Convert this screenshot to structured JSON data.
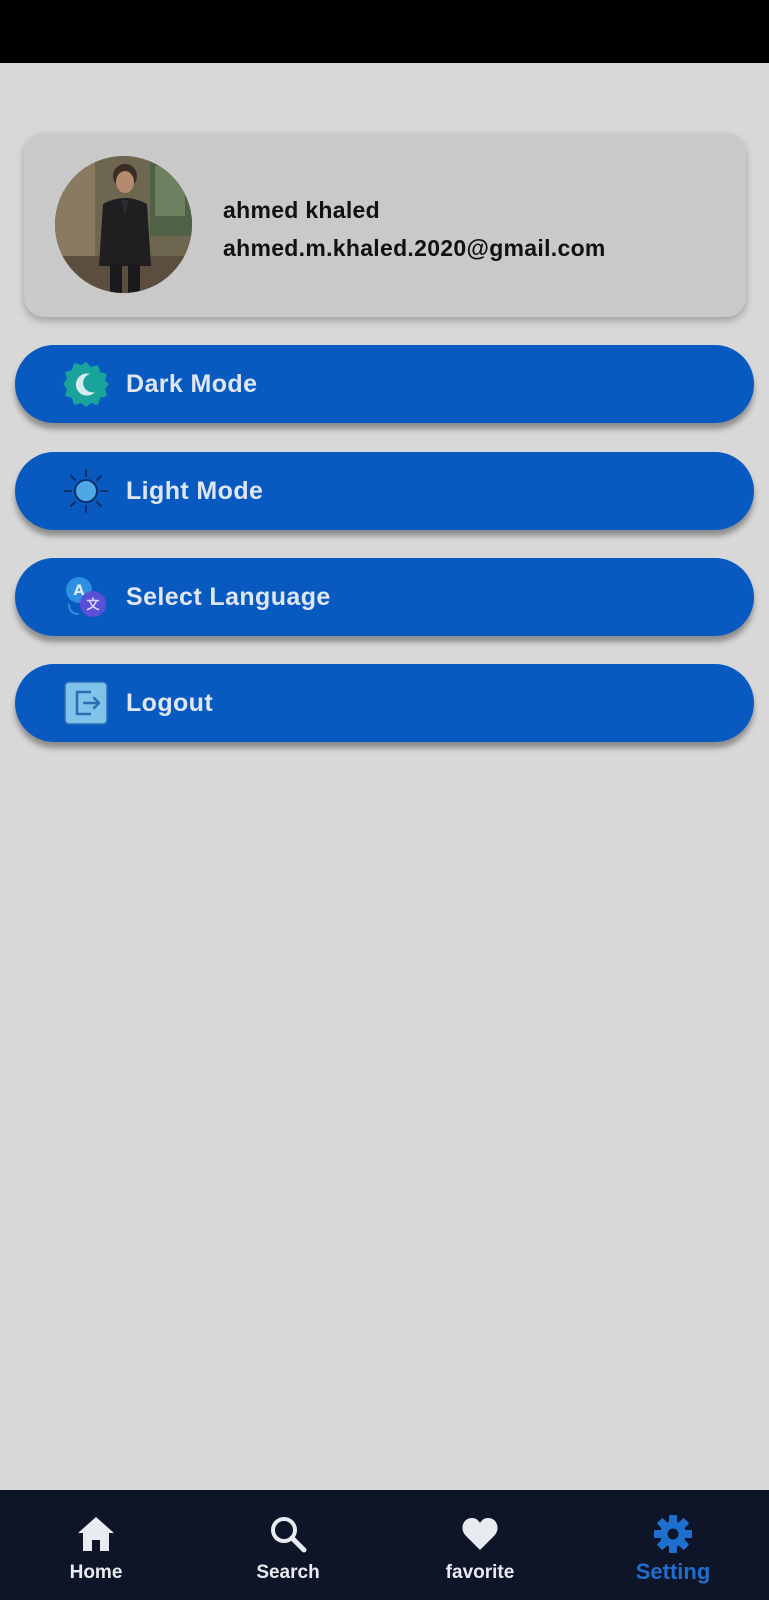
{
  "profile": {
    "name": "ahmed khaled",
    "email": "ahmed.m.khaled.2020@gmail.com"
  },
  "menu": [
    {
      "label": "Dark Mode",
      "icon": "moon-badge-icon"
    },
    {
      "label": "Light Mode",
      "icon": "sun-icon"
    },
    {
      "label": "Select Language",
      "icon": "translate-icon"
    },
    {
      "label": "Logout",
      "icon": "logout-icon"
    }
  ],
  "bottom_nav": [
    {
      "label": "Home",
      "icon": "home-icon",
      "active": false
    },
    {
      "label": "Search",
      "icon": "search-icon",
      "active": false
    },
    {
      "label": "favorite",
      "icon": "heart-icon",
      "active": false
    },
    {
      "label": "Setting",
      "icon": "gear-icon",
      "active": true
    }
  ],
  "colors": {
    "button_bg": "#085ac1",
    "nav_bg": "#0e1528",
    "active_nav": "#1f6fce",
    "screen_bg": "#d8d8d8"
  }
}
